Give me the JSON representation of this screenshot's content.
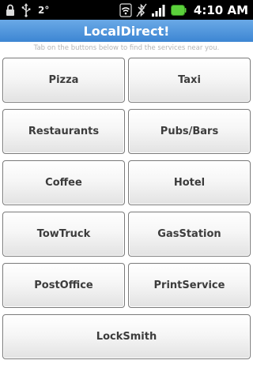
{
  "status_bar": {
    "temperature": "2°",
    "time": "4:10 AM",
    "icons": [
      "lock-icon",
      "usb-icon",
      "wifi-icon",
      "bluetooth-off-icon",
      "signal-icon",
      "battery-icon"
    ],
    "battery_color": "#5bd13b"
  },
  "app": {
    "title": "LocalDirect!",
    "subtitle": "Tab on the buttons below to find the services near you.",
    "accent_color": "#4a90d9"
  },
  "buttons": {
    "pizza": "Pizza",
    "taxi": "Taxi",
    "restaurants": "Restaurants",
    "pubs_bars": "Pubs/Bars",
    "coffee": "Coffee",
    "hotel": "Hotel",
    "towtruck": "TowTruck",
    "gasstation": "GasStation",
    "postoffice": "PostOffice",
    "printservice": "PrintService",
    "locksmith": "LockSmith"
  }
}
